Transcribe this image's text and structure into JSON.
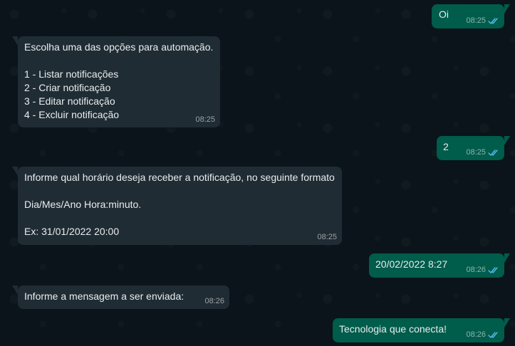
{
  "colors": {
    "background": "#0b141a",
    "incoming_bubble": "#202c33",
    "outgoing_bubble": "#005c4b",
    "read_ticks": "#53bdeb",
    "text": "#e9edef"
  },
  "messages": [
    {
      "direction": "outgoing",
      "text": "Oi",
      "time": "08:25",
      "status_icon": "double-check-read-icon"
    },
    {
      "direction": "incoming",
      "text": "Escolha uma das opções para automação.\n\n1 - Listar notificações\n2 - Criar notificação\n3 - Editar notificação\n4 - Excluir notificação",
      "time": "08:25"
    },
    {
      "direction": "outgoing",
      "text": "2",
      "time": "08:25",
      "status_icon": "double-check-read-icon"
    },
    {
      "direction": "incoming",
      "text": "Informe qual horário deseja receber a notificação, no seguinte formato\n\nDia/Mes/Ano Hora:minuto.\n\nEx: 31/01/2022 20:00",
      "time": "08:25"
    },
    {
      "direction": "outgoing",
      "text": "20/02/2022 8:27",
      "time": "08:26",
      "status_icon": "double-check-read-icon"
    },
    {
      "direction": "incoming",
      "text": "Informe a mensagem a ser enviada:",
      "time": "08:26"
    },
    {
      "direction": "outgoing",
      "text": "Tecnologia que conecta!",
      "time": "08:26",
      "status_icon": "double-check-read-icon"
    }
  ]
}
